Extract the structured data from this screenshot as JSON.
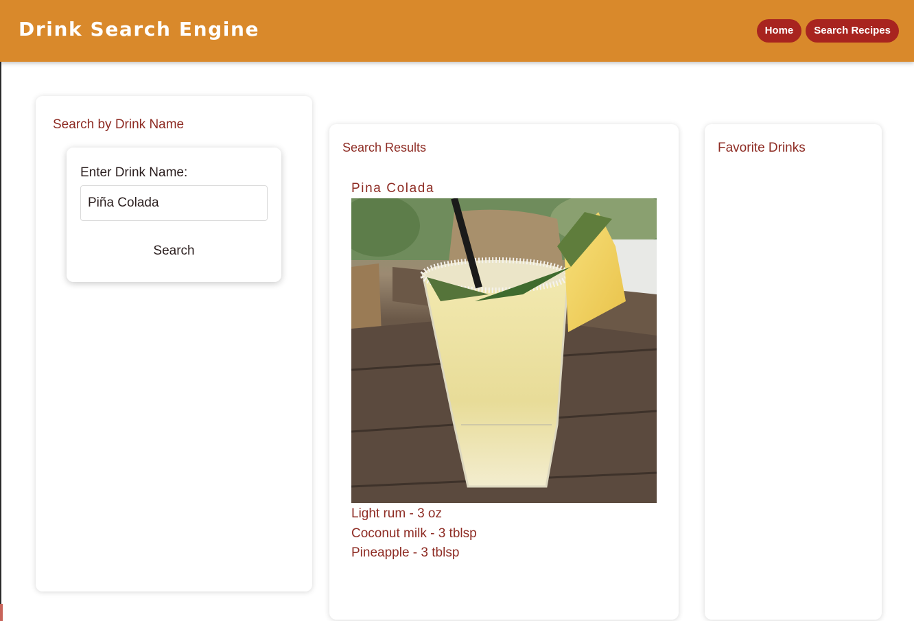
{
  "app": {
    "title": "Drink Search Engine"
  },
  "nav": {
    "home": "Home",
    "search_recipes": "Search Recipes"
  },
  "search_panel": {
    "title": "Search by Drink Name",
    "field_label": "Enter Drink Name:",
    "field_value": "Piña Colada",
    "button_label": "Search"
  },
  "results_panel": {
    "title": "Search Results",
    "drink": {
      "name": "Pina Colada",
      "photo_alt": "Pina Colada",
      "ingredients": [
        "Light rum - 3 oz",
        "Coconut milk - 3 tblsp",
        "Pineapple - 3 tblsp"
      ]
    }
  },
  "favorites_panel": {
    "title": "Favorite Drinks"
  },
  "colors": {
    "header": "#d9892b",
    "nav_button": "#a8241f",
    "accent_text": "#8e2c24",
    "page_bg": "#ffffff"
  }
}
